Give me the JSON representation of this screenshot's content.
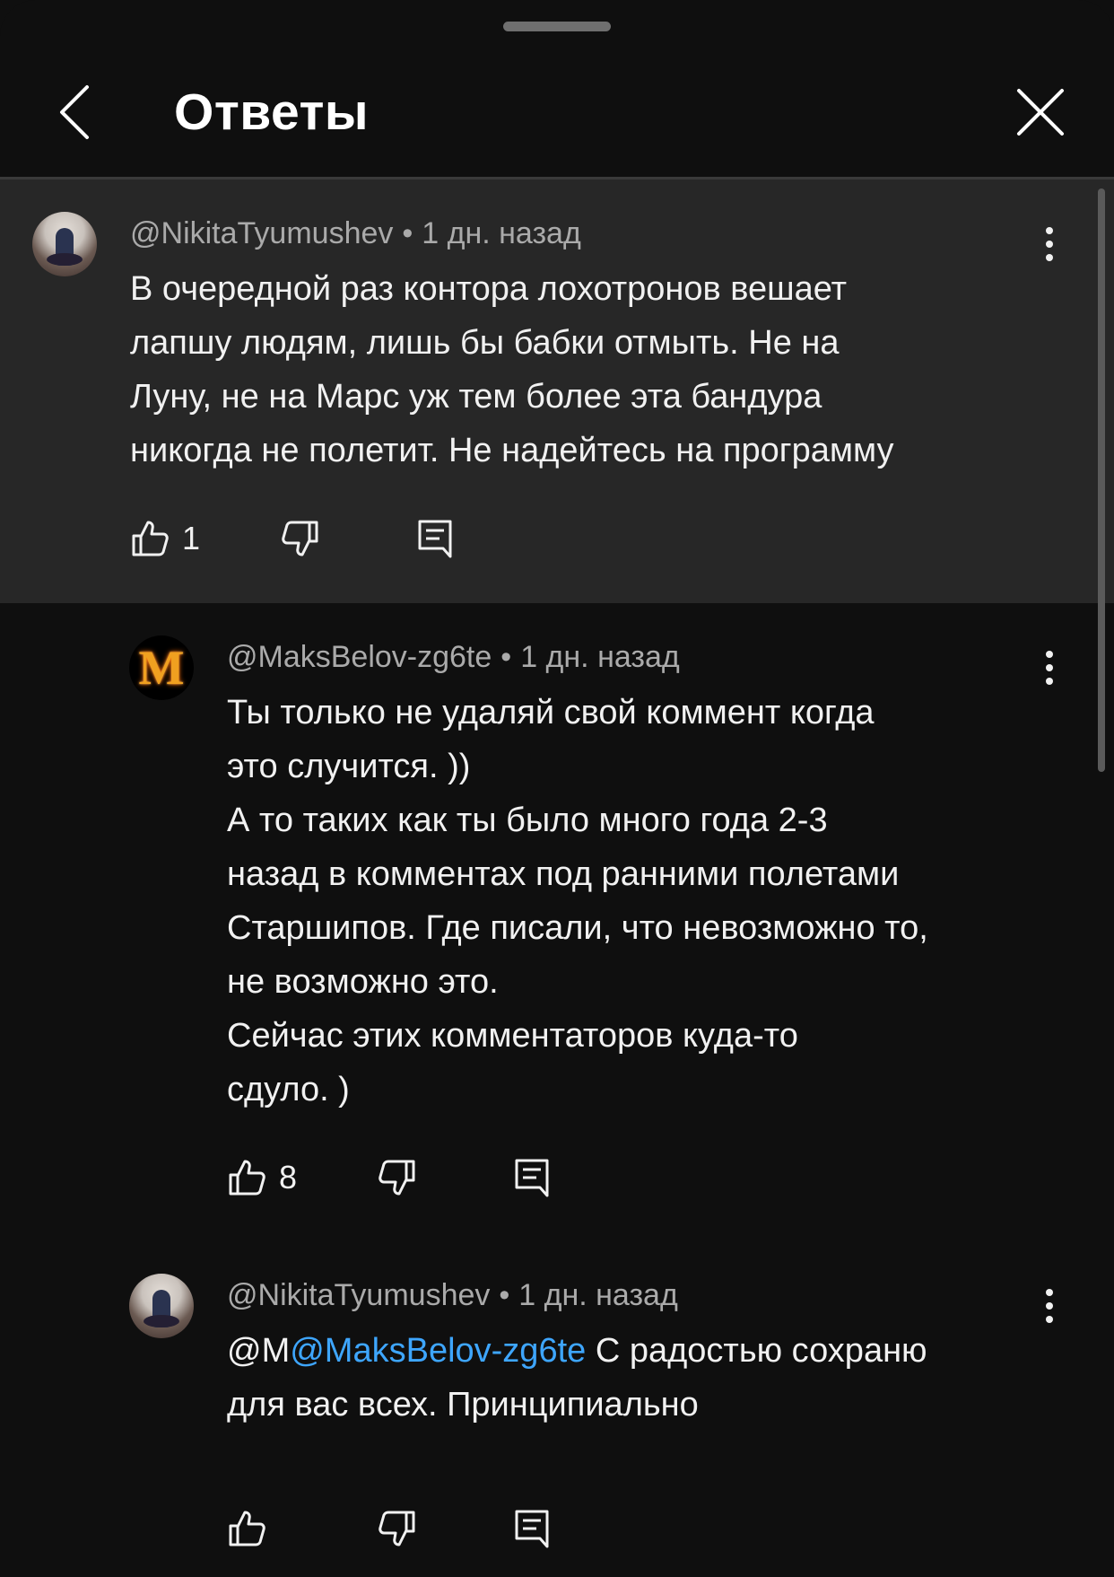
{
  "header": {
    "title": "Ответы"
  },
  "comments": [
    {
      "author": "@NikitaTyumushev",
      "time": "1 дн. назад",
      "text": "В очередной раз контора лохотронов вешает\nлапшу людям, лишь бы бабки отмыть. Не на\nЛуну, не на Марс уж тем более эта бандура\nникогда не полетит. Не надейтесь на программу",
      "likes": "1"
    },
    {
      "author": "@MaksBelov-zg6te",
      "avatar_letter": "M",
      "time": "1 дн. назад",
      "text": "Ты только не удаляй свой коммент когда\nэто случится. ))\nА то таких как ты было много года 2-3\nназад в комментах под ранними полетами\nСтаршипов. Где писали, что невозможно то,\nне возможно это.\nСейчас этих комментаторов куда-то\nсдуло. )",
      "likes": "8"
    },
    {
      "author": "@NikitaTyumushev",
      "time": "1 дн. назад",
      "mention_prefix": "@M",
      "mention": "@MaksBelov-zg6te",
      "text_after_mention": " С радостью сохраню\nдля вас всех. Принципиально",
      "likes": ""
    }
  ],
  "meta_separator": "•",
  "colors": {
    "background": "#0f0f0f",
    "highlight": "#272727",
    "link": "#3ea6ff",
    "secondary_text": "#aaaaaa"
  },
  "icons": [
    "back-arrow-icon",
    "close-icon",
    "more-vert-icon",
    "thumb-up-icon",
    "thumb-down-icon",
    "reply-icon"
  ]
}
